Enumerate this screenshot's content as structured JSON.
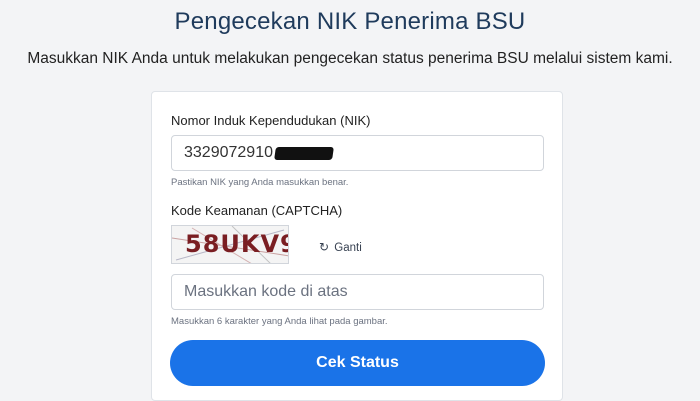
{
  "header": {
    "title": "Pengecekan NIK Penerima BSU",
    "subtitle": "Masukkan NIK Anda untuk melakukan pengecekan status penerima BSU melalui sistem kami."
  },
  "form": {
    "nik": {
      "label": "Nomor Induk Kependudukan (NIK)",
      "value": "3329072910",
      "help": "Pastikan NIK yang Anda masukkan benar."
    },
    "captcha": {
      "label": "Kode Keamanan (CAPTCHA)",
      "image_text": "58UKV9",
      "refresh_label": "Ganti",
      "refresh_icon": "refresh-icon",
      "input_placeholder": "Masukkan kode di atas",
      "help": "Masukkan 6 karakter yang Anda lihat pada gambar."
    },
    "submit_label": "Cek Status"
  },
  "colors": {
    "accent": "#1a73e8",
    "title": "#1f3b5c",
    "captcha_text": "#7a1e22"
  }
}
